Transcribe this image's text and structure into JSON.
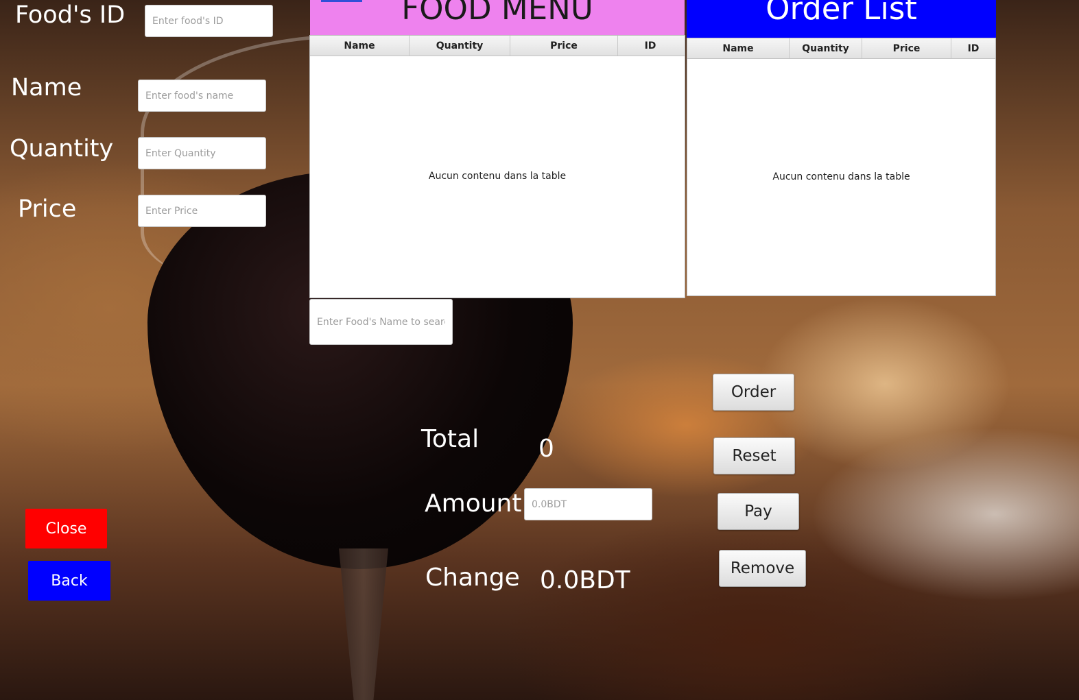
{
  "form": {
    "food_id_label": "Food's ID",
    "food_id_placeholder": "Enter food's ID",
    "name_label": "Name",
    "name_placeholder": "Enter food's name",
    "quantity_label": "Quantity",
    "quantity_placeholder": "Enter Quantity",
    "price_label": "Price",
    "price_placeholder": "Enter Price"
  },
  "food_menu": {
    "title": "FOOD MENU",
    "title_bg": "#ee82ee",
    "columns": [
      "Name",
      "Quantity",
      "Price",
      "ID"
    ],
    "empty_text": "Aucun contenu dans la table",
    "search_placeholder": "Enter Food's Name to search"
  },
  "order_list": {
    "title": "Order List",
    "title_bg": "#0000ff",
    "columns": [
      "Name",
      "Quantity",
      "Price",
      "ID"
    ],
    "empty_text": "Aucun contenu dans la table"
  },
  "summary": {
    "total_label": "Total",
    "total_value": "0",
    "amount_label": "Amount",
    "amount_placeholder": "0.0BDT",
    "change_label": "Change",
    "change_value": "0.0BDT"
  },
  "actions": {
    "order": "Order",
    "reset": "Reset",
    "pay": "Pay",
    "remove": "Remove",
    "close": "Close",
    "close_color": "#ff0000",
    "back": "Back",
    "back_color": "#0000ff"
  }
}
